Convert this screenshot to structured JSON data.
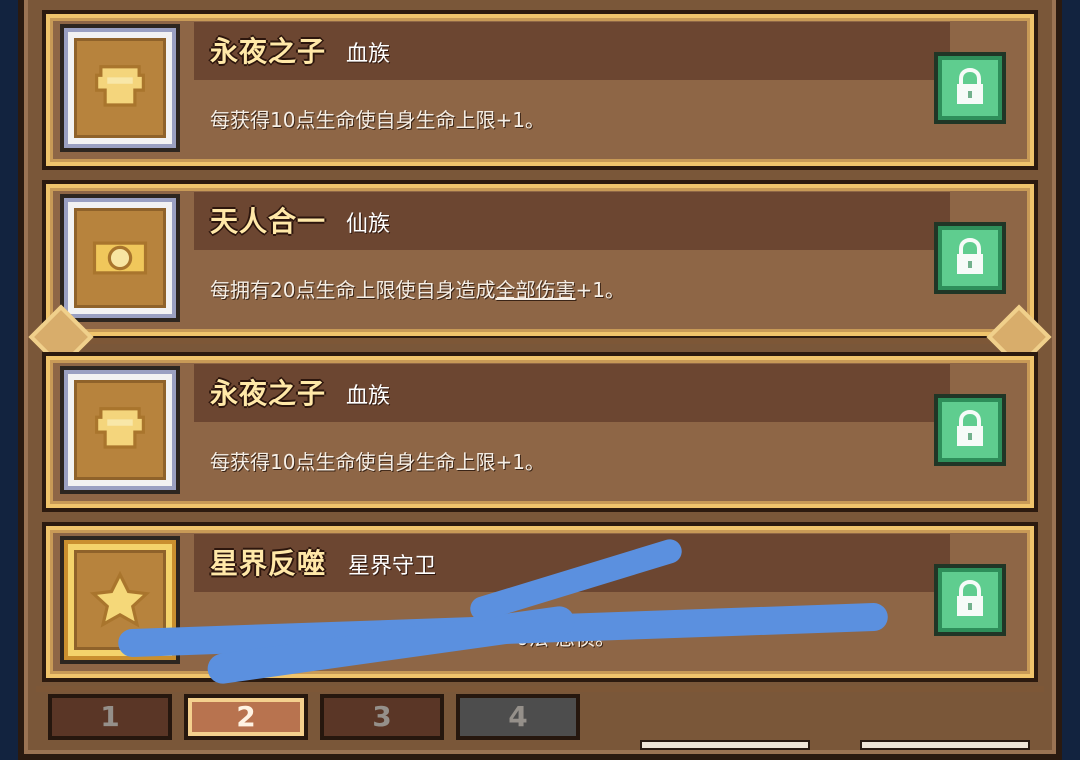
{
  "cards": [
    {
      "title": "永夜之子",
      "subtitle": "血族",
      "description": "每获得10点生命使自身生命上限+1。",
      "icon": "chalice-icon",
      "style": "silver"
    },
    {
      "title": "天人合一",
      "subtitle": "仙族",
      "description_prefix": "每拥有20点生命上限使自身造成",
      "description_underlined": "全部伤害",
      "description_suffix": "+1。",
      "icon": "ring-icon",
      "style": "silver"
    },
    {
      "title": "永夜之子",
      "subtitle": "血族",
      "description": "每获得10点生命使自身生命上限+1。",
      "icon": "chalice-icon",
      "style": "silver"
    },
    {
      "title": "星界反噬",
      "subtitle": "星界守卫",
      "description_visible": "0法 恶侦。",
      "icon": "star-icon",
      "style": "gold"
    }
  ],
  "pagination": {
    "pages": [
      "1",
      "2",
      "3",
      "4"
    ],
    "active_page": "2"
  }
}
